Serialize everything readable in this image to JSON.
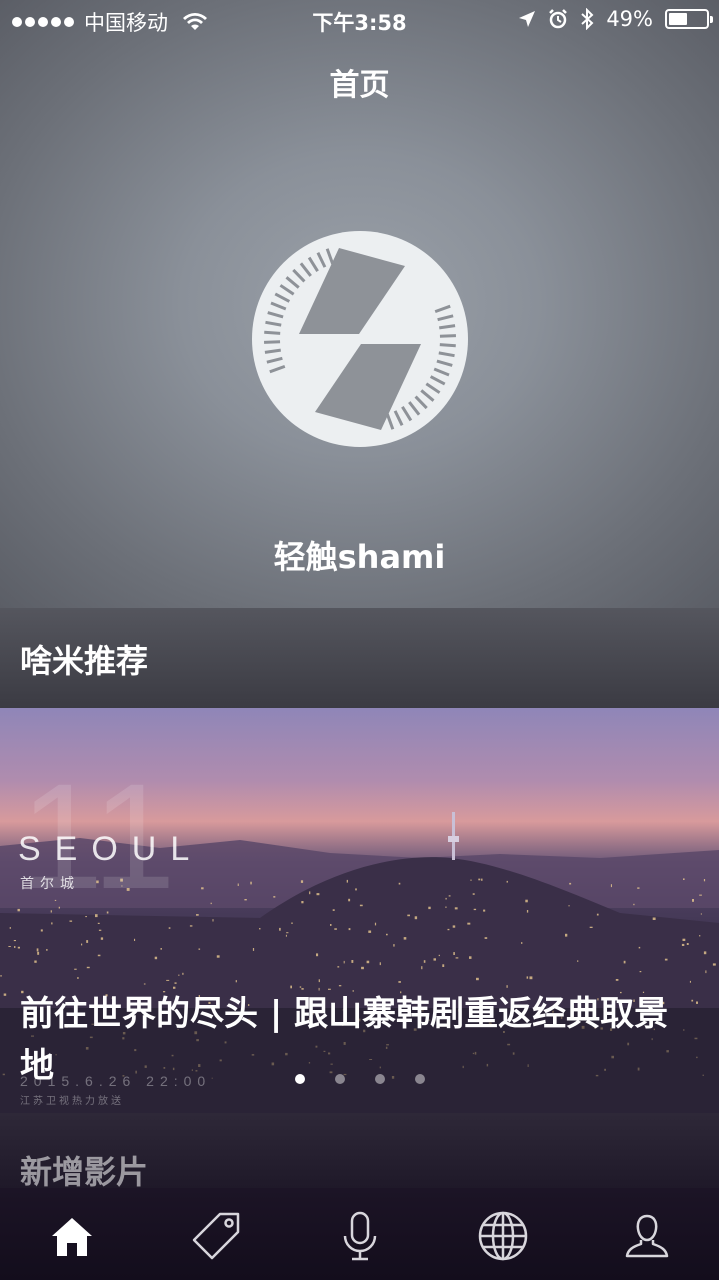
{
  "status_bar": {
    "carrier": "中国移动",
    "time": "下午3:58",
    "battery_text": "49%",
    "battery_level": 0.49
  },
  "nav": {
    "title": "首页"
  },
  "hero": {
    "logo_icon": "shami-logo-icon",
    "caption": "轻触shami"
  },
  "recommend": {
    "title": "啥米推荐"
  },
  "banner": {
    "title": "前往世界的尽头 | 跟山寨韩剧重返经典取景地",
    "art_text": {
      "big_number": "11",
      "city_en": "SEOUL",
      "city_cn": "首尔城",
      "date": "2015.6.26 22:00",
      "broadcaster": "江苏卫视热力放送"
    },
    "pages": 4,
    "active_page": 0
  },
  "new_films": {
    "title": "新增影片"
  },
  "tab_bar": {
    "items": [
      {
        "name": "home",
        "icon": "home-icon",
        "active": true
      },
      {
        "name": "tags",
        "icon": "tag-icon",
        "active": false
      },
      {
        "name": "voice",
        "icon": "microphone-icon",
        "active": false
      },
      {
        "name": "explore",
        "icon": "globe-icon",
        "active": false
      },
      {
        "name": "profile",
        "icon": "user-icon",
        "active": false
      }
    ]
  }
}
